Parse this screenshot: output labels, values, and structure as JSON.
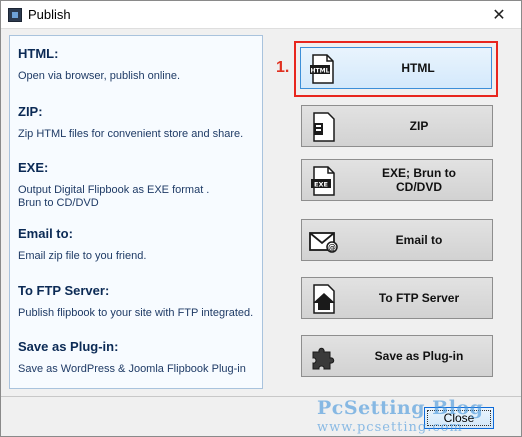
{
  "window": {
    "title": "Publish",
    "close_glyph": "✕"
  },
  "sections": [
    {
      "title": "HTML:",
      "desc": "Open via browser, publish online."
    },
    {
      "title": "ZIP:",
      "desc": "Zip HTML files for convenient store and share."
    },
    {
      "title": "EXE:",
      "desc": "Output Digital Flipbook as EXE format .\nBrun to CD/DVD"
    },
    {
      "title": "Email to:",
      "desc": "Email zip file to you friend."
    },
    {
      "title": "To FTP Server:",
      "desc": "Publish flipbook to your site with FTP integrated."
    },
    {
      "title": "Save as Plug-in:",
      "desc": "Save as WordPress & Joomla Flipbook Plug-in"
    }
  ],
  "buttons": {
    "html": {
      "label": "HTML",
      "icon_text": "HTML",
      "icon": "html-file-icon"
    },
    "zip": {
      "label": "ZIP",
      "icon": "zip-file-icon"
    },
    "exe": {
      "label": "EXE; Brun to\nCD/DVD",
      "icon_text": "EXE",
      "icon": "exe-file-icon"
    },
    "email": {
      "label": "Email to",
      "icon": "envelope-icon"
    },
    "ftp": {
      "label": "To FTP Server",
      "icon": "upload-house-icon"
    },
    "plugin": {
      "label": "Save as Plug-in",
      "icon": "puzzle-piece-icon"
    }
  },
  "annotation": {
    "step": "1."
  },
  "footer": {
    "close_label": "Close"
  },
  "watermark": {
    "title": "PcSetting Blog",
    "url": "www.pcsetting.com"
  },
  "colors": {
    "highlight": "#e8261e",
    "accent": "#3c8fd8",
    "heading": "#0b2a55"
  }
}
